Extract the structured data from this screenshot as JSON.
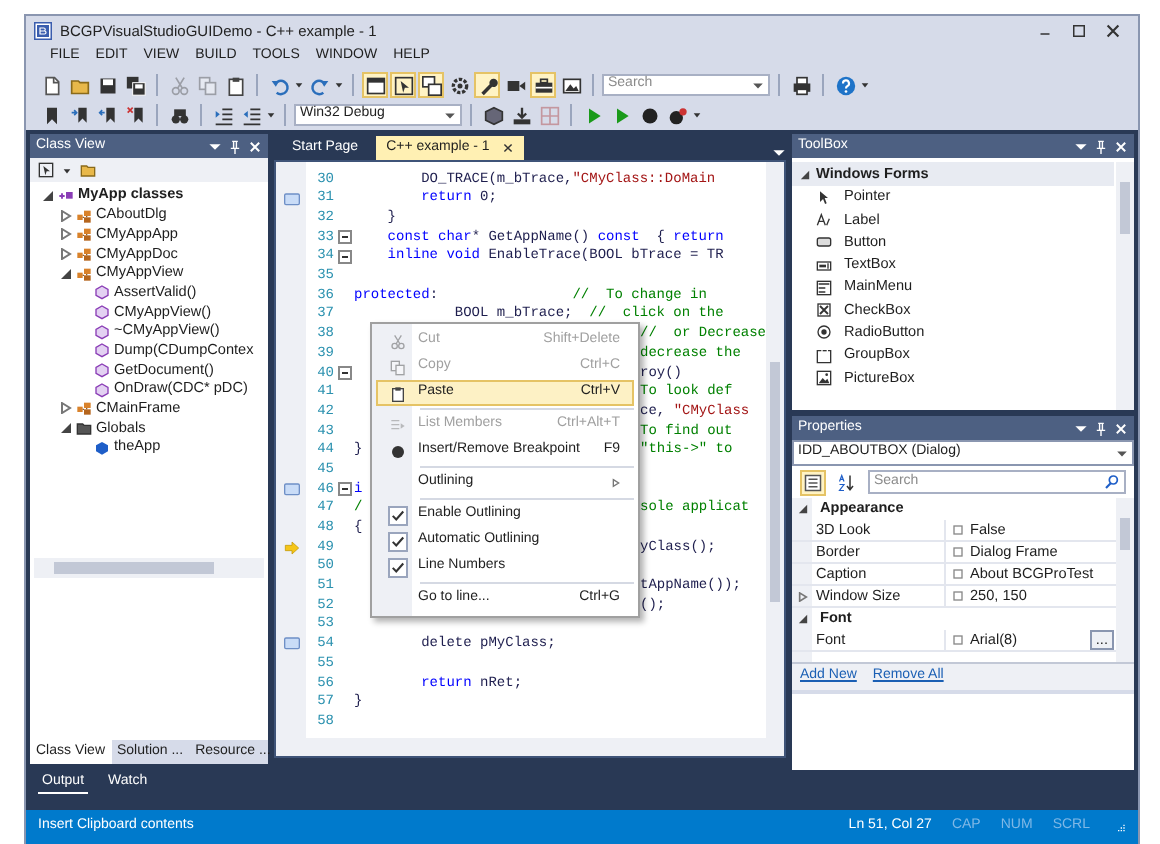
{
  "window": {
    "title": "BCGPVisualStudioGUIDemo - C++ example - 1"
  },
  "menu_bar": [
    "FILE",
    "EDIT",
    "VIEW",
    "BUILD",
    "TOOLS",
    "WINDOW",
    "HELP"
  ],
  "toolbar_1": [
    {
      "kind": "button",
      "on": false,
      "disabled": false
    },
    {
      "kind": "button",
      "on": false,
      "disabled": false
    },
    {
      "kind": "button",
      "on": false,
      "disabled": false
    },
    {
      "kind": "button",
      "on": false,
      "disabled": false
    },
    {
      "kind": "separator"
    },
    {
      "kind": "button",
      "on": false,
      "disabled": true
    },
    {
      "kind": "button",
      "on": false,
      "disabled": true
    },
    {
      "kind": "button",
      "on": false,
      "disabled": false
    },
    {
      "kind": "separator"
    },
    {
      "kind": "button",
      "on": false,
      "disabled": false
    },
    {
      "kind": "caret"
    },
    {
      "kind": "button",
      "on": false,
      "disabled": false
    },
    {
      "kind": "caret"
    },
    {
      "kind": "separator"
    },
    {
      "kind": "button",
      "on": true,
      "disabled": false
    },
    {
      "kind": "button",
      "on": true,
      "disabled": false
    },
    {
      "kind": "button",
      "on": true,
      "disabled": false
    },
    {
      "kind": "button",
      "on": false,
      "disabled": false
    },
    {
      "kind": "button",
      "on": true,
      "disabled": false
    },
    {
      "kind": "button",
      "on": false,
      "disabled": false
    },
    {
      "kind": "button",
      "on": true,
      "disabled": false
    },
    {
      "kind": "button",
      "on": false,
      "disabled": false
    },
    {
      "kind": "separator"
    },
    {
      "kind": "combo",
      "placeholder": "Search"
    },
    {
      "kind": "separator"
    },
    {
      "kind": "button",
      "on": false,
      "disabled": false
    },
    {
      "kind": "separator"
    },
    {
      "kind": "button",
      "on": false,
      "disabled": false
    },
    {
      "kind": "caret"
    }
  ],
  "toolbar_2": [
    {
      "kind": "button",
      "on": false,
      "disabled": false
    },
    {
      "kind": "button",
      "on": false,
      "disabled": false
    },
    {
      "kind": "button",
      "on": false,
      "disabled": false
    },
    {
      "kind": "button",
      "on": false,
      "disabled": false
    },
    {
      "kind": "separator"
    },
    {
      "kind": "button",
      "on": false,
      "disabled": false
    },
    {
      "kind": "separator"
    },
    {
      "kind": "button",
      "on": false,
      "disabled": false
    },
    {
      "kind": "button",
      "on": false,
      "disabled": false
    },
    {
      "kind": "caret"
    },
    {
      "kind": "separator"
    },
    {
      "kind": "combo",
      "value": "Win32 Debug"
    },
    {
      "kind": "separator"
    },
    {
      "kind": "button",
      "on": false,
      "disabled": false
    },
    {
      "kind": "button",
      "on": false,
      "disabled": false
    },
    {
      "kind": "button",
      "on": false,
      "disabled": true
    },
    {
      "kind": "separator"
    },
    {
      "kind": "button",
      "on": false,
      "disabled": false
    },
    {
      "kind": "button",
      "on": false,
      "disabled": false
    },
    {
      "kind": "button",
      "on": false,
      "disabled": false
    },
    {
      "kind": "button",
      "on": false,
      "disabled": false
    },
    {
      "kind": "caret"
    }
  ],
  "class_view": {
    "title": "Class View",
    "tree": [
      {
        "label": "MyApp classes",
        "kind": "namespace",
        "expanded": true,
        "children": [
          {
            "label": "CAboutDlg",
            "kind": "class",
            "expanded": false
          },
          {
            "label": "CMyAppApp",
            "kind": "class",
            "expanded": false
          },
          {
            "label": "CMyAppDoc",
            "kind": "class",
            "expanded": false
          },
          {
            "label": "CMyAppView",
            "kind": "class",
            "expanded": true,
            "children": [
              {
                "label": "AssertValid()",
                "kind": "method"
              },
              {
                "label": "CMyAppView()",
                "kind": "method"
              },
              {
                "label": "~CMyAppView()",
                "kind": "method"
              },
              {
                "label": "Dump(CDumpContex",
                "kind": "method"
              },
              {
                "label": "GetDocument()",
                "kind": "method"
              },
              {
                "label": "OnDraw(CDC* pDC)",
                "kind": "method"
              }
            ]
          },
          {
            "label": "CMainFrame",
            "kind": "class",
            "expanded": false
          },
          {
            "label": "Globals",
            "kind": "folder",
            "expanded": true,
            "children": [
              {
                "label": "theApp",
                "kind": "variable"
              }
            ]
          }
        ]
      }
    ],
    "tabs": [
      {
        "label": "Class View",
        "selected": true
      },
      {
        "label": "Solution ...",
        "selected": false
      },
      {
        "label": "Resource ...",
        "selected": false
      }
    ]
  },
  "bottom_tabs": [
    {
      "label": "Output",
      "selected": true
    },
    {
      "label": "Watch",
      "selected": false
    }
  ],
  "editor": {
    "tabs": [
      {
        "label": "Start Page",
        "selected": false
      },
      {
        "label": "C++ example - 1",
        "selected": true
      }
    ],
    "lines": [
      {
        "number": "30",
        "bookmark": false,
        "current": false,
        "fold": false,
        "code": [
          {
            "kind": "plain",
            "text": "        DO_TRACE(m_bTrace,"
          },
          {
            "kind": "string",
            "text": "\"CMyClass::DoMain"
          }
        ]
      },
      {
        "number": "31",
        "bookmark": true,
        "current": false,
        "fold": false,
        "code": [
          {
            "kind": "keyword",
            "text": "        return"
          },
          {
            "kind": "plain",
            "text": " 0;"
          }
        ]
      },
      {
        "number": "32",
        "bookmark": false,
        "current": false,
        "fold": false,
        "code": [
          {
            "kind": "plain",
            "text": "    }"
          }
        ]
      },
      {
        "number": "33",
        "bookmark": false,
        "current": false,
        "fold": true,
        "code": [
          {
            "kind": "keyword",
            "text": "    const char"
          },
          {
            "kind": "plain",
            "text": "* GetAppName() "
          },
          {
            "kind": "keyword",
            "text": "const"
          },
          {
            "kind": "plain",
            "text": "  { "
          },
          {
            "kind": "keyword",
            "text": "return"
          }
        ]
      },
      {
        "number": "34",
        "bookmark": false,
        "current": false,
        "fold": true,
        "code": [
          {
            "kind": "keyword",
            "text": "    inline void"
          },
          {
            "kind": "plain",
            "text": " EnableTrace(BOOL bTrace = TR"
          }
        ]
      },
      {
        "number": "35",
        "bookmark": false,
        "current": false,
        "fold": false
      },
      {
        "number": "36",
        "bookmark": false,
        "current": false,
        "fold": false,
        "code": [
          {
            "kind": "keyword",
            "text": "protected"
          },
          {
            "kind": "plain",
            "text": ":                "
          },
          {
            "kind": "comment",
            "text": "//  To change in"
          }
        ]
      },
      {
        "number": "37",
        "bookmark": false,
        "current": false,
        "fold": false,
        "code": [
          {
            "kind": "plain",
            "text": "            BOOL m_bTrace;  "
          },
          {
            "kind": "comment",
            "text": "//  click on the"
          }
        ]
      },
      {
        "number": "38",
        "bookmark": false,
        "current": false,
        "fold": false,
        "tail": [
          {
            "kind": "comment",
            "text": "//  or Decrease"
          }
        ]
      },
      {
        "number": "39",
        "bookmark": false,
        "current": false,
        "fold": false,
        "tail": [
          {
            "kind": "comment",
            "text": "decrease the"
          }
        ]
      },
      {
        "number": "40",
        "bookmark": false,
        "current": false,
        "fold": true,
        "tail": [
          {
            "kind": "plain",
            "text": "roy()"
          }
        ]
      },
      {
        "number": "41",
        "bookmark": false,
        "current": false,
        "fold": false,
        "tail": [
          {
            "kind": "comment",
            "text": "To look def"
          }
        ]
      },
      {
        "number": "42",
        "bookmark": false,
        "current": false,
        "fold": false,
        "tail": [
          {
            "kind": "plain",
            "text": "ce, "
          },
          {
            "kind": "string",
            "text": "\"CMyClass"
          }
        ]
      },
      {
        "number": "43",
        "bookmark": false,
        "current": false,
        "fold": false,
        "tail": [
          {
            "kind": "comment",
            "text": "To find out"
          }
        ]
      },
      {
        "number": "44",
        "bookmark": false,
        "current": false,
        "fold": false,
        "code": [
          {
            "kind": "plain",
            "text": "}"
          }
        ],
        "tail": [
          {
            "kind": "comment",
            "text": "\"this->\" to"
          }
        ]
      },
      {
        "number": "45",
        "bookmark": false,
        "current": false,
        "fold": false
      },
      {
        "number": "46",
        "bookmark": true,
        "current": false,
        "fold": true,
        "code": [
          {
            "kind": "keyword",
            "text": "i"
          }
        ]
      },
      {
        "number": "47",
        "bookmark": false,
        "current": false,
        "fold": false,
        "code": [
          {
            "kind": "comment",
            "text": "/"
          }
        ],
        "tail": [
          {
            "kind": "comment",
            "text": "sole applicat"
          }
        ]
      },
      {
        "number": "48",
        "bookmark": false,
        "current": false,
        "fold": false,
        "code": [
          {
            "kind": "plain",
            "text": "{"
          }
        ]
      },
      {
        "number": "49",
        "bookmark": false,
        "current": true,
        "fold": false,
        "tail": [
          {
            "kind": "plain",
            "text": "yClass();"
          }
        ]
      },
      {
        "number": "50",
        "bookmark": false,
        "current": false,
        "fold": false
      },
      {
        "number": "51",
        "bookmark": false,
        "current": false,
        "fold": false,
        "tail": [
          {
            "kind": "plain",
            "text": "tAppName());"
          }
        ]
      },
      {
        "number": "52",
        "bookmark": false,
        "current": false,
        "fold": false,
        "tail": [
          {
            "kind": "plain",
            "text": "();"
          }
        ]
      },
      {
        "number": "53",
        "bookmark": false,
        "current": false,
        "fold": false
      },
      {
        "number": "54",
        "bookmark": true,
        "current": false,
        "fold": false,
        "code": [
          {
            "kind": "plain",
            "text": "        delete pMyClass;"
          }
        ]
      },
      {
        "number": "55",
        "bookmark": false,
        "current": false,
        "fold": false
      },
      {
        "number": "56",
        "bookmark": false,
        "current": false,
        "fold": false,
        "code": [
          {
            "kind": "keyword",
            "text": "        return"
          },
          {
            "kind": "plain",
            "text": " nRet;"
          }
        ]
      },
      {
        "number": "57",
        "bookmark": false,
        "current": false,
        "fold": false,
        "code": [
          {
            "kind": "plain",
            "text": "}"
          }
        ]
      },
      {
        "number": "58",
        "bookmark": false,
        "current": false,
        "fold": false
      }
    ]
  },
  "context_menu": [
    {
      "kind": "command",
      "label": "Cut",
      "shortcut": "Shift+Delete",
      "disabled": true,
      "selected": false
    },
    {
      "kind": "command",
      "label": "Copy",
      "shortcut": "Ctrl+C",
      "disabled": true,
      "selected": false
    },
    {
      "kind": "command",
      "label": "Paste",
      "shortcut": "Ctrl+V",
      "disabled": false,
      "selected": true
    },
    {
      "kind": "separator"
    },
    {
      "kind": "command",
      "label": "List Members",
      "shortcut": "Ctrl+Alt+T",
      "disabled": true,
      "selected": false
    },
    {
      "kind": "command",
      "label": "Insert/Remove Breakpoint",
      "shortcut": "F9",
      "disabled": false,
      "selected": false
    },
    {
      "kind": "separator"
    },
    {
      "kind": "submenu",
      "label": "Outlining",
      "disabled": false,
      "selected": false
    },
    {
      "kind": "separator"
    },
    {
      "kind": "check",
      "label": "Enable Outlining",
      "checked": true,
      "disabled": false,
      "selected": false
    },
    {
      "kind": "check",
      "label": "Automatic Outlining",
      "checked": true,
      "disabled": false,
      "selected": false
    },
    {
      "kind": "check",
      "label": "Line Numbers",
      "checked": true,
      "disabled": false,
      "selected": false
    },
    {
      "kind": "separator"
    },
    {
      "kind": "command",
      "label": "Go to line...",
      "shortcut": "Ctrl+G",
      "disabled": false,
      "selected": false
    }
  ],
  "toolbox": {
    "title": "ToolBox",
    "group": {
      "label": "Windows Forms",
      "expanded": true
    },
    "items": [
      "Pointer",
      "Label",
      "Button",
      "TextBox",
      "MainMenu",
      "CheckBox",
      "RadioButton",
      "GroupBox",
      "PictureBox"
    ]
  },
  "properties": {
    "title": "Properties",
    "object": "IDD_ABOUTBOX (Dialog)",
    "categorized": true,
    "alphabetical": false,
    "search_placeholder": "Search",
    "groups": [
      {
        "label": "Appearance",
        "expanded": true,
        "rows": [
          {
            "name": "3D Look",
            "value": "False",
            "expandable": false
          },
          {
            "name": "Border",
            "value": "Dialog Frame",
            "expandable": false
          },
          {
            "name": "Caption",
            "value": "About BCGProTest",
            "expandable": false
          },
          {
            "name": "Window Size",
            "value": "250, 150",
            "expandable": true,
            "expanded": false
          }
        ]
      },
      {
        "label": "Font",
        "expanded": true,
        "rows": [
          {
            "name": "Font",
            "value": "Arial(8)",
            "expandable": false,
            "button": "..."
          }
        ]
      }
    ],
    "links": [
      "Add New",
      "Remove All"
    ]
  },
  "status_bar": {
    "message": "Insert Clipboard contents",
    "position": "Ln 51, Col 27",
    "indicators": [
      {
        "label": "CAP",
        "on": false
      },
      {
        "label": "NUM",
        "on": false
      },
      {
        "label": "SCRL",
        "on": false
      }
    ]
  }
}
